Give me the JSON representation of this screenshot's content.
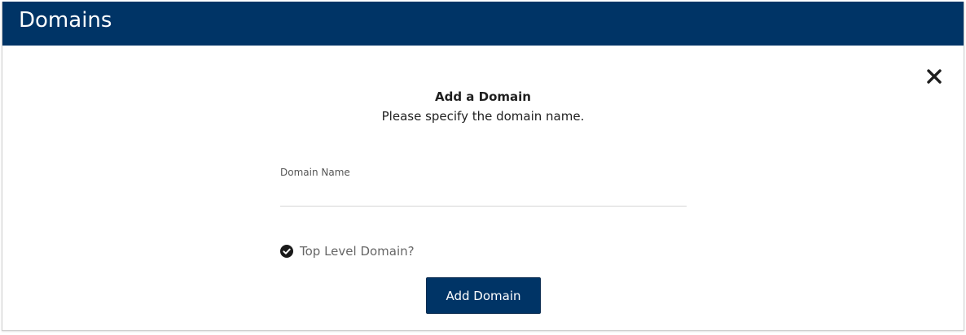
{
  "header": {
    "title": "Domains",
    "background": "#003466"
  },
  "dialog": {
    "title": "Add a Domain",
    "subtitle": "Please specify the domain name.",
    "close_icon": "close-icon",
    "domain_field": {
      "label": "Domain Name",
      "value": "",
      "placeholder": ""
    },
    "top_level_checkbox": {
      "label": "Top Level Domain?",
      "checked": true,
      "icon": "check-circle-icon"
    },
    "submit_label": "Add Domain",
    "accent_color": "#003466"
  }
}
